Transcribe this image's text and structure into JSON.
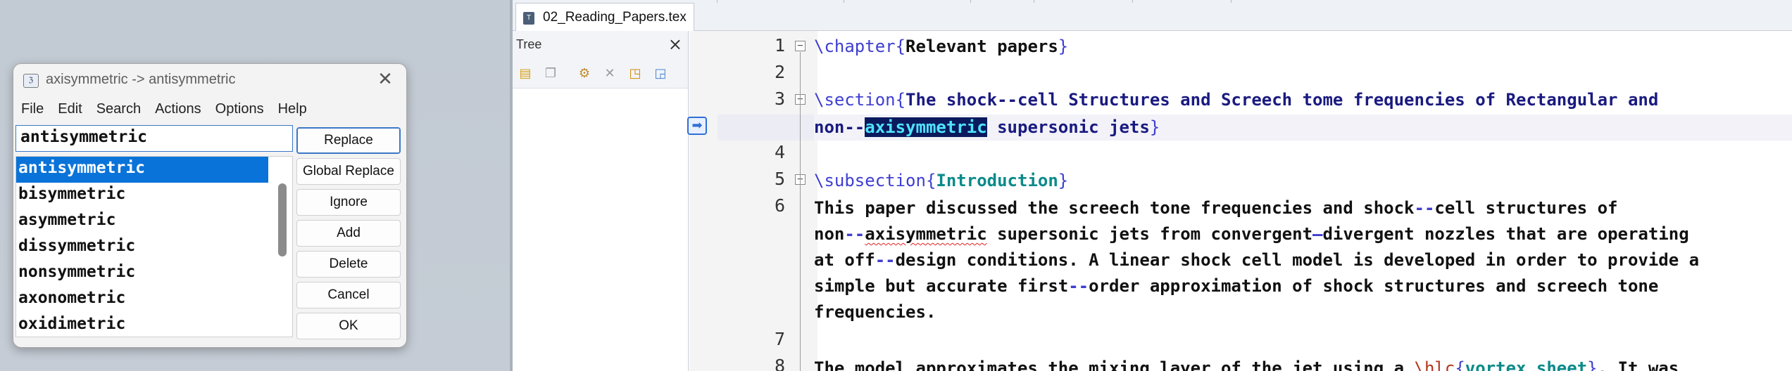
{
  "dialog": {
    "title": "axisymmetric -> antisymmetric",
    "menu": [
      "File",
      "Edit",
      "Search",
      "Actions",
      "Options",
      "Help"
    ],
    "replacement_value": "antisymmetric",
    "suggestions": [
      "antisymmetric",
      "bisymmetric",
      "asymmetric",
      "dissymmetric",
      "nonsymmetric",
      "axonometric",
      "oxidimetric"
    ],
    "selected_index": 0,
    "buttons": {
      "replace": "Replace",
      "global_replace": "Global Replace",
      "ignore": "Ignore",
      "add": "Add",
      "delete": "Delete",
      "cancel": "Cancel",
      "ok": "OK"
    }
  },
  "editor": {
    "tab_label": "02_Reading_Papers.tex",
    "tree": {
      "title": "Tree",
      "close": "×"
    },
    "line_numbers": [
      "1",
      "2",
      "3",
      "4",
      "5",
      "6",
      "7",
      "8"
    ],
    "lines": {
      "l1_cmd": "\\chapter",
      "l1_open": "{",
      "l1_arg": "Relevant papers",
      "l1_close": "}",
      "l3_cmd": "\\section",
      "l3_open": "{",
      "l3_arg": "The shock--cell Structures and Screech tome frequencies of Rectangular and",
      "l3b_pre": "non--",
      "l3b_sel": "axisymmetric",
      "l3b_post": " supersonic jets",
      "l3b_close": "}",
      "l5_cmd": "\\subsection",
      "l5_open": "{",
      "l5_arg": "Introduction",
      "l5_close": "}",
      "l6a_p1": "This paper discussed the screech tone frequencies and shock",
      "l6a_d1": "--",
      "l6a_p2": "cell structures of",
      "l6b_p1": "non",
      "l6b_d1": "--",
      "l6b_mis": "axisymmetric",
      "l6b_p2": " supersonic jets from convergent",
      "l6b_d2": "–",
      "l6b_p3": "divergent nozzles that are operating",
      "l6c_p1": "at off",
      "l6c_d1": "--",
      "l6c_p2": "design conditions. A linear shock cell model is developed in order to provide a",
      "l6d_p1": "simple but accurate first",
      "l6d_d1": "--",
      "l6d_p2": "order approximation of shock structures and screech tone",
      "l6e_p1": "frequencies.",
      "l8_p1": "The model approximates the mixing layer of the jet using a ",
      "l8_cmd": "\\hlc",
      "l8_open": "{",
      "l8_arg": "vortex sheet",
      "l8_close": "}",
      "l8_p2": ". It was"
    }
  }
}
